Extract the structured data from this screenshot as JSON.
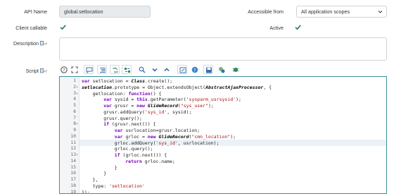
{
  "form": {
    "api_name_label": "API Name",
    "api_name_value": "global.setlocation",
    "accessible_from_label": "Accessible from",
    "accessible_from_value": "All application scopes",
    "client_callable_label": "Client callable",
    "client_callable_checked": true,
    "active_label": "Active",
    "active_checked": true,
    "description_label": "Description",
    "description_value": "",
    "script_label": "Script"
  },
  "toolbar": {
    "icons": [
      "help-icon",
      "fullscreen-icon",
      "comment-icon",
      "format-icon",
      "replace-icon",
      "replace-all-icon",
      "search-icon",
      "collapse-icon",
      "expand-icon",
      "script-tree-icon",
      "syntax-help-icon",
      "save-icon",
      "toggle-syntax-icon",
      "debug-icon"
    ]
  },
  "editor": {
    "highlight_line": 11,
    "lines": [
      {
        "n": "1",
        "fold": "",
        "indent": 0,
        "html": "<span class=\"kw\">var</span> setlocation = <span class=\"cls\">Class</span>.create();"
      },
      {
        "n": "2",
        "fold": "▾",
        "indent": 0,
        "html": "<span class=\"cls\">setlocation</span>.prototype = Object.extendsObject(<span class=\"cls\">AbstractAjaxProcessor</span>, {"
      },
      {
        "n": "3",
        "fold": "▾",
        "indent": 1,
        "html": "getlocation: <span class=\"kw\">function</span>() {"
      },
      {
        "n": "4",
        "fold": "",
        "indent": 2,
        "html": "<span class=\"kw\">var</span> sysid = <span class=\"kw\">this</span>.getParameter(<span class=\"str\">'sysparm_usrsysid'</span>);"
      },
      {
        "n": "5",
        "fold": "",
        "indent": 2,
        "html": "<span class=\"kw\">var</span> grusr = <span class=\"kw\">new</span> <span class=\"cls\">GlideRecord</span>(<span class=\"str\">\"sys_user\"</span>);"
      },
      {
        "n": "6",
        "fold": "",
        "indent": 2,
        "html": "grusr.addQuery(<span class=\"str\">'sys_id'</span>, sysid);"
      },
      {
        "n": "7",
        "fold": "",
        "indent": 2,
        "html": "grusr.query();"
      },
      {
        "n": "8",
        "fold": "▾",
        "indent": 2,
        "html": "<span class=\"kw\">if</span> (grusr.next()) {"
      },
      {
        "n": "9",
        "fold": "",
        "indent": 3,
        "html": "<span class=\"kw\">var</span> usrlocation=grusr.location;"
      },
      {
        "n": "10",
        "fold": "",
        "indent": 3,
        "html": "<span class=\"kw\">var</span> grloc = <span class=\"kw\">new</span> <span class=\"cls\">GlideRecord</span>(<span class=\"str\">\"cmn_location\"</span>);"
      },
      {
        "n": "11",
        "fold": "",
        "indent": 3,
        "html": "grloc.addQuery(<span class=\"str\">'sys_id'</span>, usrlocation);"
      },
      {
        "n": "12",
        "fold": "",
        "indent": 3,
        "html": "grloc.query();"
      },
      {
        "n": "13",
        "fold": "▾",
        "indent": 3,
        "html": "<span class=\"kw\">if</span> (grloc.next()) {"
      },
      {
        "n": "14",
        "fold": "",
        "indent": 4,
        "html": "<span class=\"kw\">return</span> grloc.name;"
      },
      {
        "n": "15",
        "fold": "",
        "indent": 3,
        "html": "}"
      },
      {
        "n": "16",
        "fold": "",
        "indent": 2,
        "html": "}"
      },
      {
        "n": "17",
        "fold": "",
        "indent": 1,
        "html": "},"
      },
      {
        "n": "18",
        "fold": "",
        "indent": 1,
        "html": "type: <span class=\"str\">'setlocation'</span>"
      },
      {
        "n": "19",
        "fold": "",
        "indent": 0,
        "html": "});"
      }
    ]
  }
}
